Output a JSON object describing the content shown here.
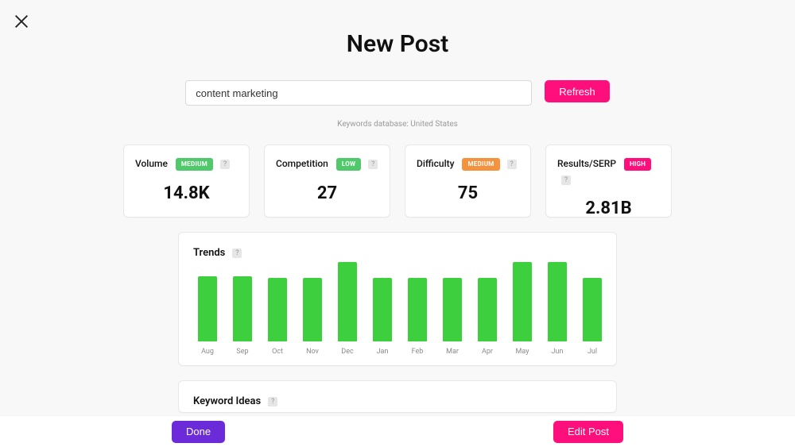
{
  "header": {
    "title": "New Post"
  },
  "search": {
    "value": "content marketing",
    "refresh_label": "Refresh",
    "db_note": "Keywords database: United States"
  },
  "cards": {
    "volume": {
      "label": "Volume",
      "badge": "MEDIUM",
      "value": "14.8K"
    },
    "competition": {
      "label": "Competition",
      "badge": "LOW",
      "value": "27"
    },
    "difficulty": {
      "label": "Difficulty",
      "badge": "MEDIUM",
      "value": "75"
    },
    "results": {
      "label": "Results/SERP",
      "badge": "HIGH",
      "value": "2.81B"
    }
  },
  "trends": {
    "title": "Trends",
    "categories": [
      "Aug",
      "Sep",
      "Oct",
      "Nov",
      "Dec",
      "Jan",
      "Feb",
      "Mar",
      "Apr",
      "May",
      "Jun",
      "Jul"
    ],
    "values": [
      82,
      82,
      80,
      80,
      100,
      80,
      80,
      80,
      80,
      100,
      100,
      80
    ]
  },
  "ideas": {
    "title": "Keyword Ideas"
  },
  "footer": {
    "done_label": "Done",
    "edit_label": "Edit Post"
  },
  "help_glyph": "?",
  "chart_data": {
    "type": "bar",
    "title": "Trends",
    "xlabel": "",
    "ylabel": "",
    "ylim": [
      0,
      100
    ],
    "categories": [
      "Aug",
      "Sep",
      "Oct",
      "Nov",
      "Dec",
      "Jan",
      "Feb",
      "Mar",
      "Apr",
      "May",
      "Jun",
      "Jul"
    ],
    "values": [
      82,
      82,
      80,
      80,
      100,
      80,
      80,
      80,
      80,
      100,
      100,
      80
    ]
  }
}
